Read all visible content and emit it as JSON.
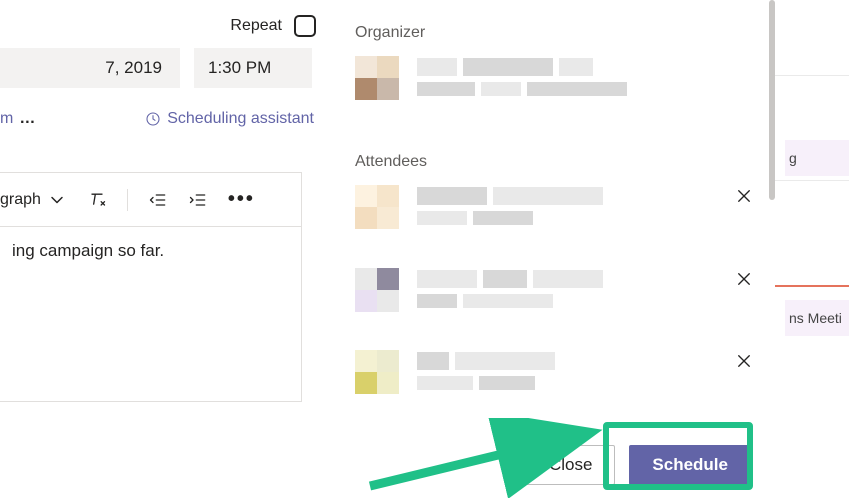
{
  "form": {
    "repeat_label": "Repeat",
    "repeat_checked": false,
    "end_date": "7, 2019",
    "end_time": "1:30 PM",
    "location_fragment": "m",
    "scheduling_assistant": "Scheduling assistant",
    "paragraph_label": "graph",
    "body_fragment": "ing campaign so far."
  },
  "people": {
    "organizer_label": "Organizer",
    "attendees_label": "Attendees"
  },
  "buttons": {
    "close": "Close",
    "schedule": "Schedule"
  },
  "calendar_bg": {
    "event1": "g",
    "event2": "ns Meeti"
  },
  "colors": {
    "primary": "#6264a7",
    "highlight": "#20c088"
  },
  "avatar_palettes": {
    "organizer": [
      "#f2e6d8",
      "#ebd9bf",
      "#af8a6d",
      "#c9b8aa"
    ],
    "a1": [
      "#fdf2e0",
      "#f6e5cb",
      "#f3ddbf",
      "#f8ead4"
    ],
    "a2": [
      "#e9e9e9",
      "#8f8a9e",
      "#e9e0f2",
      "#e9e9e9"
    ],
    "a3": [
      "#f4f1d2",
      "#ecebcf",
      "#d9d06a",
      "#efedc7"
    ]
  }
}
